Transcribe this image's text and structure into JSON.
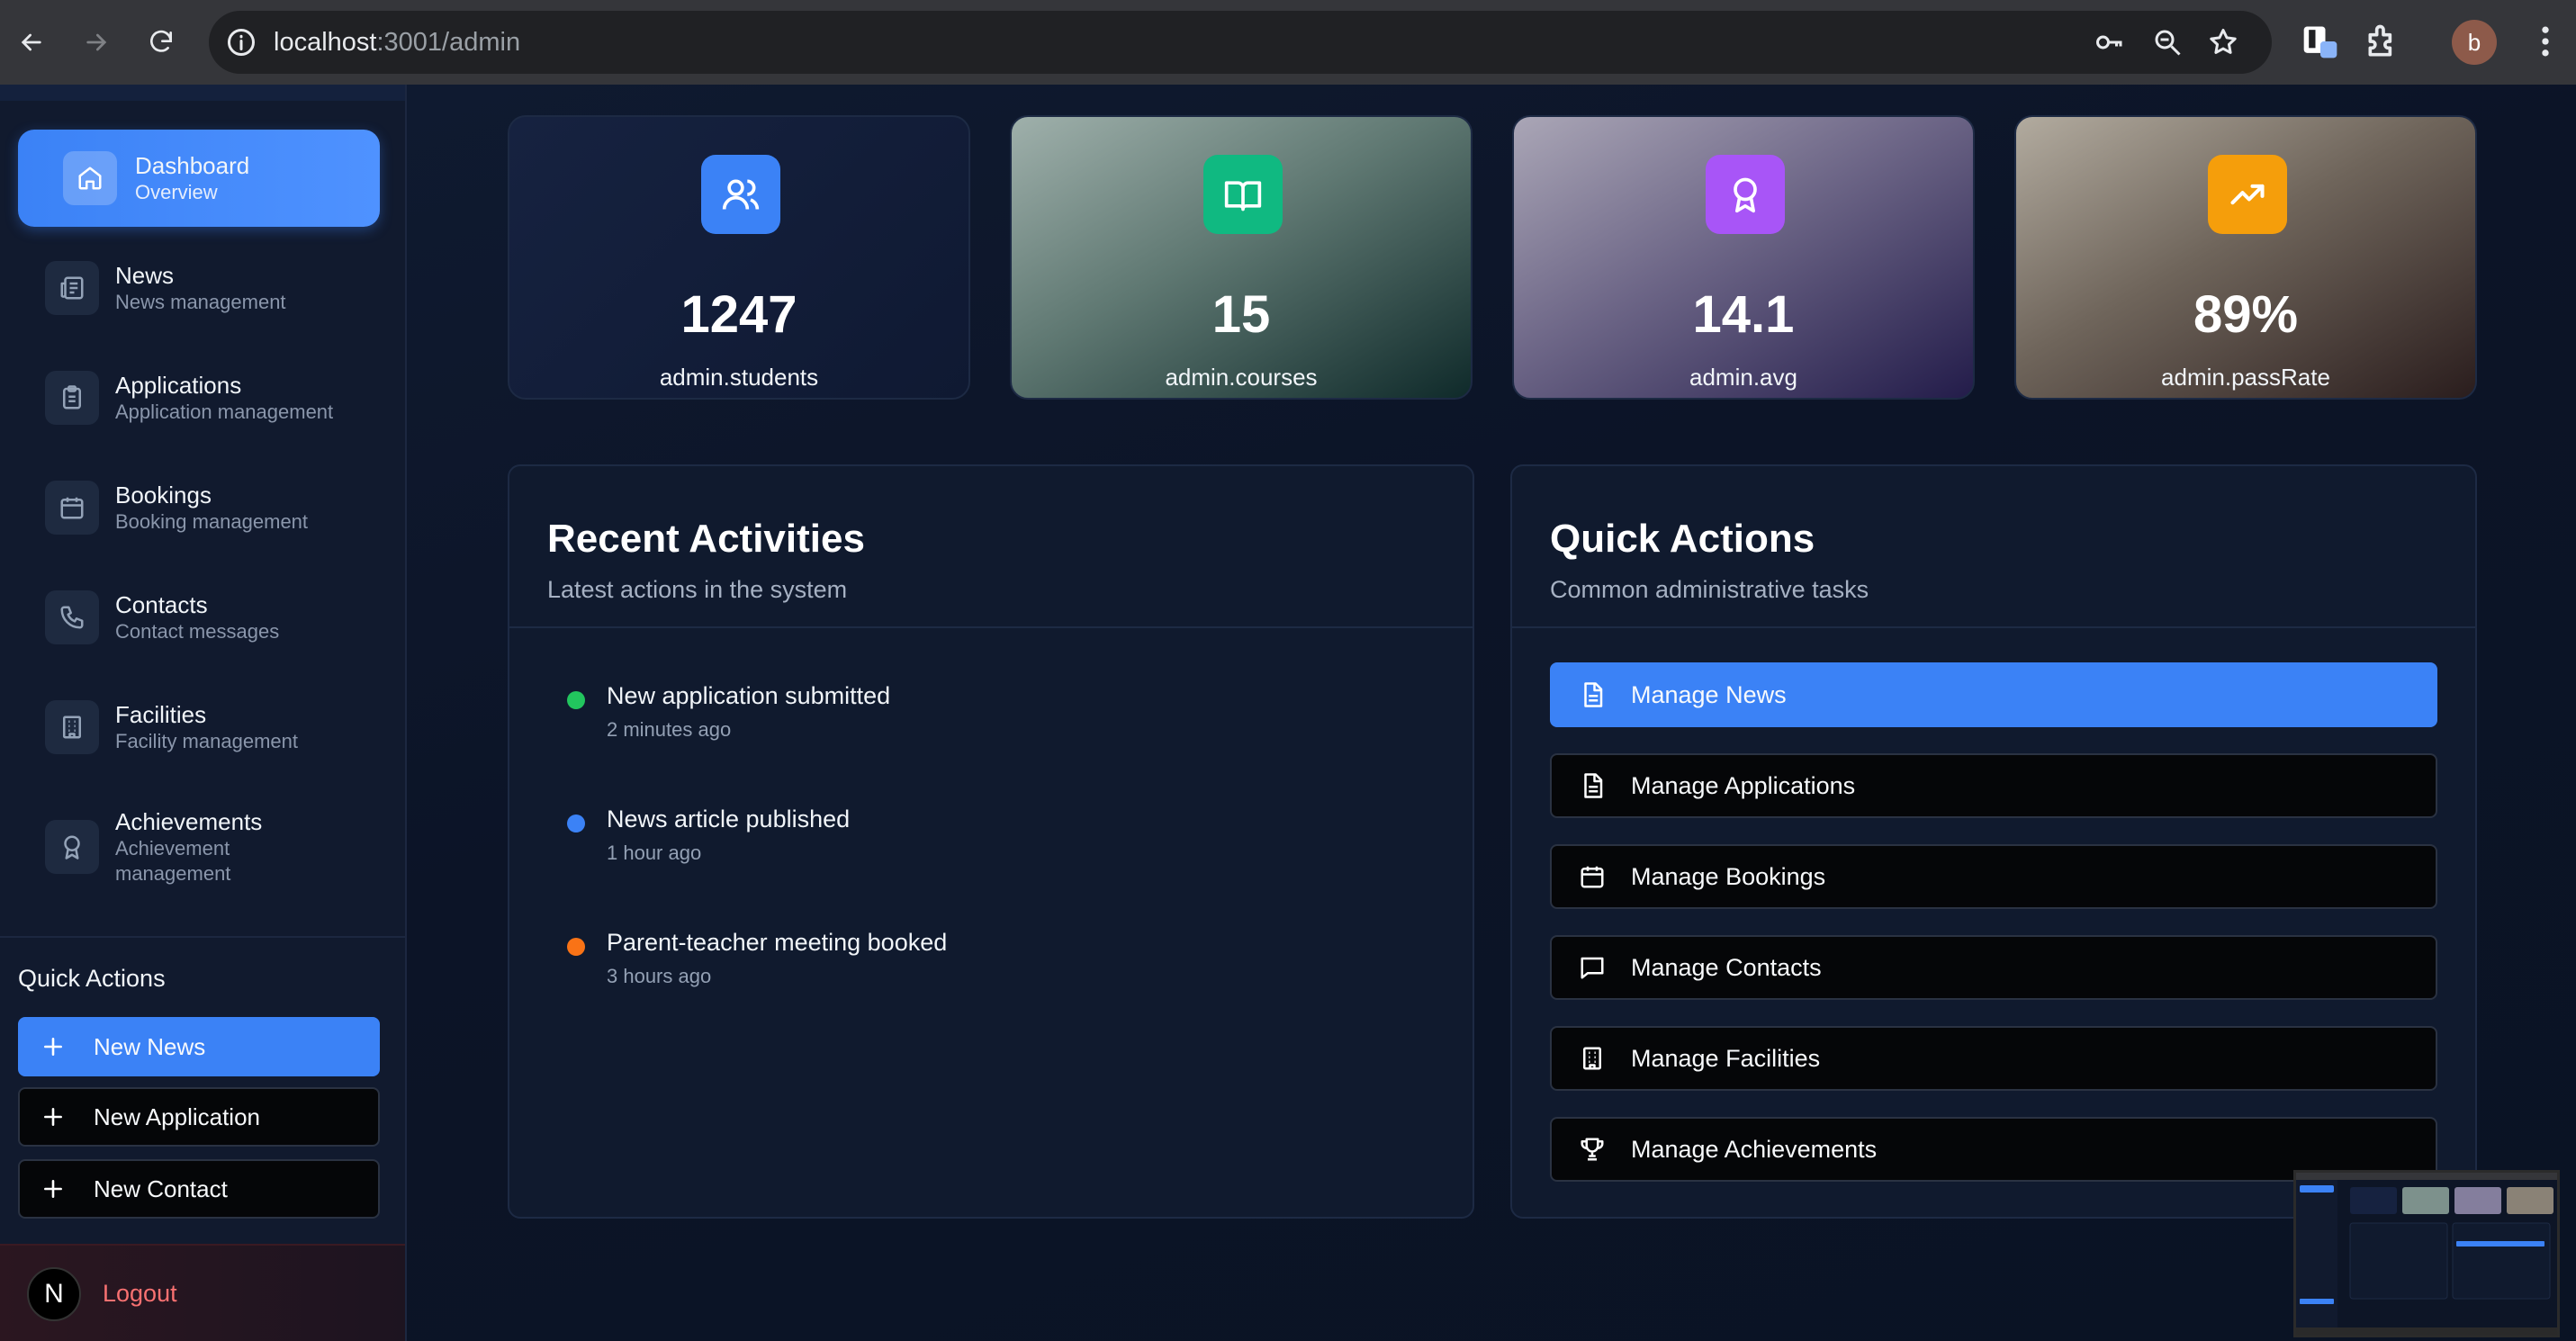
{
  "browser": {
    "url_host": "localhost",
    "url_path": ":3001/admin",
    "profile_initial": "b"
  },
  "sidebar": {
    "items": [
      {
        "label": "Dashboard",
        "sub": "Overview",
        "icon": "home-icon"
      },
      {
        "label": "News",
        "sub": "News management",
        "icon": "newspaper-icon"
      },
      {
        "label": "Applications",
        "sub": "Application management",
        "icon": "clipboard-icon"
      },
      {
        "label": "Bookings",
        "sub": "Booking management",
        "icon": "calendar-icon"
      },
      {
        "label": "Contacts",
        "sub": "Contact messages",
        "icon": "phone-icon"
      },
      {
        "label": "Facilities",
        "sub": "Facility management",
        "icon": "building-icon"
      },
      {
        "label": "Achievements",
        "sub_line1": "Achievement",
        "sub_line2": "management",
        "icon": "award-icon"
      }
    ],
    "quick_actions_title": "Quick Actions",
    "quick_actions": [
      "New News",
      "New Application",
      "New Contact"
    ],
    "logout_label": "Logout",
    "avatar_letter": "N"
  },
  "stats": [
    {
      "value": "1247",
      "label": "admin.students",
      "icon": "users-icon",
      "color": "#3b82f6"
    },
    {
      "value": "15",
      "label": "admin.courses",
      "icon": "book-open-icon",
      "color": "#10b981"
    },
    {
      "value": "14.1",
      "label": "admin.avg",
      "icon": "award-icon",
      "color": "#a855f7"
    },
    {
      "value": "89%",
      "label": "admin.passRate",
      "icon": "trending-up-icon",
      "color": "#f59e0b"
    }
  ],
  "recent": {
    "title": "Recent Activities",
    "subtitle": "Latest actions in the system",
    "items": [
      {
        "title": "New application submitted",
        "time": "2 minutes ago",
        "color": "#22c55e"
      },
      {
        "title": "News article published",
        "time": "1 hour ago",
        "color": "#3b82f6"
      },
      {
        "title": "Parent-teacher meeting booked",
        "time": "3 hours ago",
        "color": "#f97316"
      }
    ]
  },
  "quick": {
    "title": "Quick Actions",
    "subtitle": "Common administrative tasks",
    "buttons": [
      "Manage News",
      "Manage Applications",
      "Manage Bookings",
      "Manage Contacts",
      "Manage Facilities",
      "Manage Achievements"
    ]
  }
}
